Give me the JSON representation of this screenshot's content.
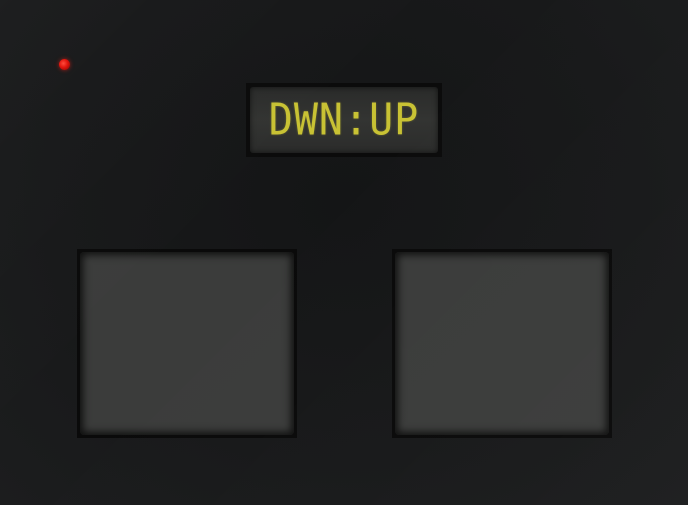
{
  "device": {
    "display": {
      "text": "DWN:UP",
      "color": "#c8c234"
    },
    "indicator_led": {
      "state": "on",
      "color": "#e0120a"
    },
    "pads": [
      {
        "id": "left-pad"
      },
      {
        "id": "right-pad"
      }
    ]
  }
}
